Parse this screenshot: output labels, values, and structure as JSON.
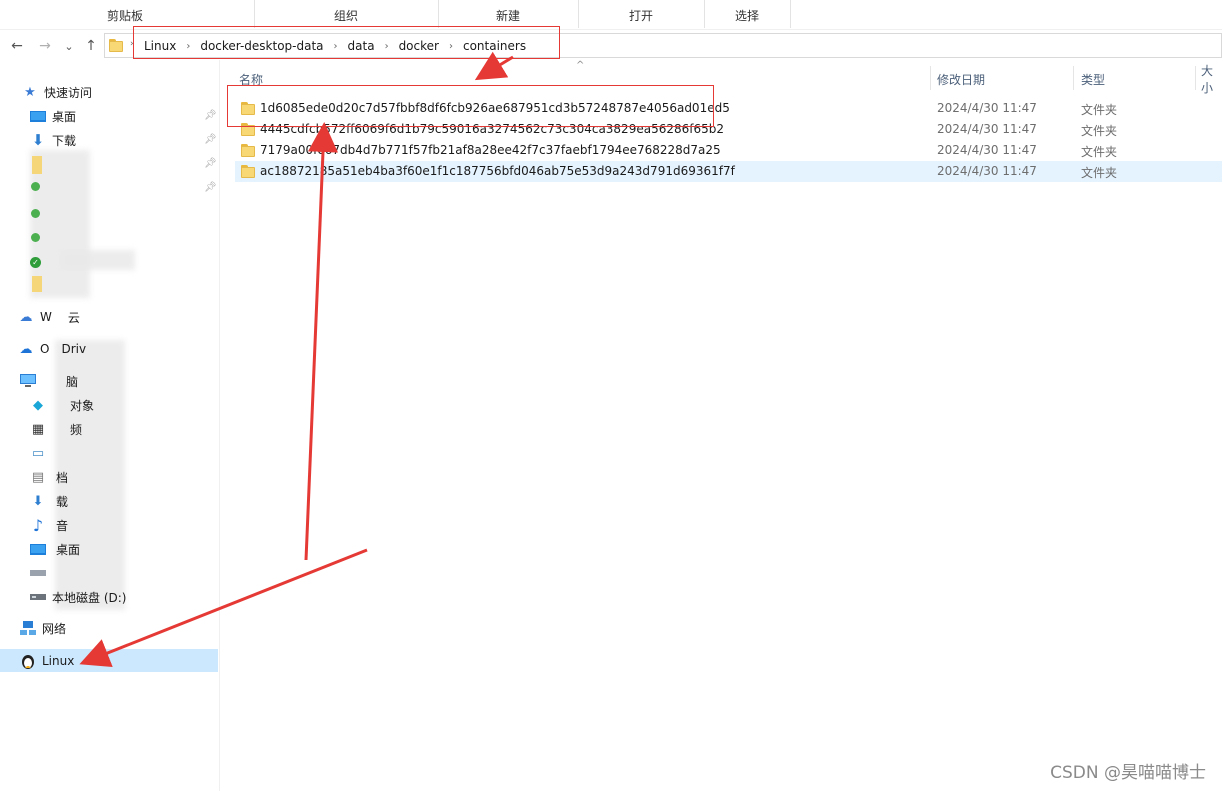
{
  "ribbon": {
    "groups": [
      "剪贴板",
      "组织",
      "新建",
      "打开",
      "选择"
    ]
  },
  "nav": {
    "back": "←",
    "forward": "→",
    "recent": "⌄",
    "up": "↑"
  },
  "breadcrumb": [
    "Linux",
    "docker-desktop-data",
    "data",
    "docker",
    "containers"
  ],
  "sidebar": {
    "quick_access": "快速访问",
    "pinned": [
      "桌面",
      "下载"
    ],
    "wps": "W",
    "wps_tail": "云",
    "onedrive": "O",
    "onedrive_tail": "Driv",
    "this_pc_tail": "脑",
    "objects_tail": "对象",
    "video_tail": "频",
    "docs_tail": "档",
    "downloads_tail": "载",
    "music_tail": "音",
    "desktop_tail": "桌面",
    "disk_d": "本地磁盘 (D:)",
    "network": "网络",
    "linux": "Linux"
  },
  "columns": {
    "name": "名称",
    "date": "修改日期",
    "type": "类型",
    "size": "大小"
  },
  "files": [
    {
      "name": "1d6085ede0d20c7d57fbbf8df6fcb926ae687951cd3b57248787e4056ad01ed5",
      "date": "2024/4/30 11:47",
      "type": "文件夹"
    },
    {
      "name": "4445cdfcb572ff6069f6d1b79c59016a3274562c73c304ca3829ea56286f65b2",
      "date": "2024/4/30 11:47",
      "type": "文件夹"
    },
    {
      "name": "7179a00fe67db4d7b771f57fb21af8a28ee42f7c37faebf1794ee768228d7a25",
      "date": "2024/4/30 11:47",
      "type": "文件夹"
    },
    {
      "name": "ac18872185a51eb4ba3f60e1f1c187756bfd046ab75e53d9a243d791d69361f7f",
      "date": "2024/4/30 11:47",
      "type": "文件夹"
    }
  ],
  "watermark": "CSDN @昊喵喵博士",
  "colors": {
    "annotation": "#e53935",
    "selection": "#cce8ff",
    "hover": "#e5f3ff",
    "folder": "#f8d775"
  }
}
